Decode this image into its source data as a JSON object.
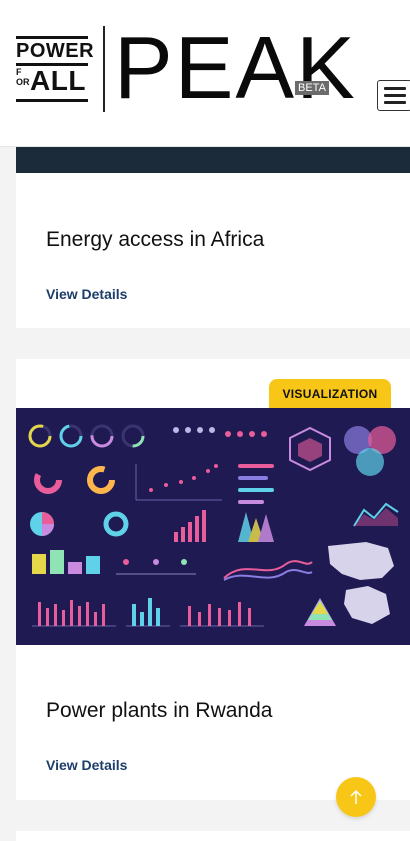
{
  "header": {
    "logo": {
      "power": "POWER",
      "for": "FOR",
      "all": "ALL"
    },
    "brand": "PEAK",
    "beta": "BETA",
    "menu_icon": "hamburger-menu-icon"
  },
  "cards": [
    {
      "title": "Energy access in Africa",
      "link": "View Details"
    },
    {
      "badge": "VISUALIZATION",
      "title": "Power plants in Rwanda",
      "link": "View Details",
      "image_icon": "infographic-dashboard-image"
    }
  ],
  "scroll_top_icon": "arrow-up-icon",
  "colors": {
    "accent": "#f7c617",
    "link": "#1d3d6a",
    "viz_bg": "#1f1a52"
  }
}
